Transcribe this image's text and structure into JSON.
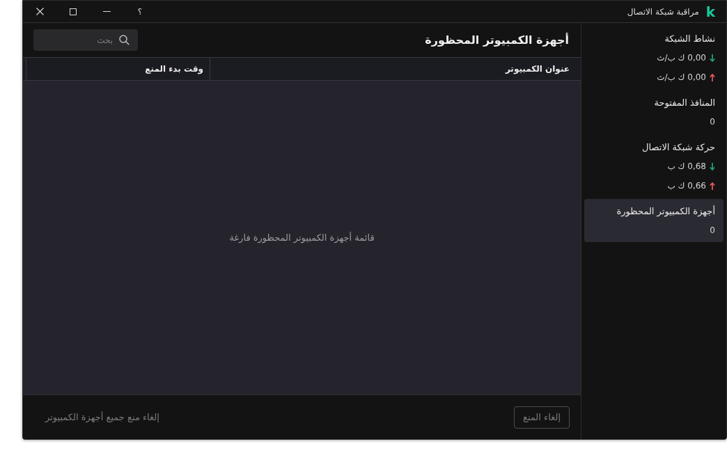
{
  "window": {
    "logo": "k",
    "title": "مراقبة شبكة الاتصال",
    "help": "؟"
  },
  "sidebar": {
    "items": [
      {
        "title": "نشاط الشبكة",
        "selected": false,
        "values": [
          {
            "kind": "down",
            "text": "0,00 ك ب/ث"
          },
          {
            "kind": "up",
            "text": "0,00 ك ب/ث"
          }
        ]
      },
      {
        "title": "المنافذ المفتوحة",
        "selected": false,
        "values": [
          {
            "kind": "plain",
            "text": "0"
          }
        ]
      },
      {
        "title": "حركة شبكة الاتصال",
        "selected": false,
        "values": [
          {
            "kind": "down",
            "text": "0,68 ك ب"
          },
          {
            "kind": "up",
            "text": "0,66 ك ب"
          }
        ]
      },
      {
        "title": "أجهزة الكمبيوتر المحظورة",
        "selected": true,
        "values": [
          {
            "kind": "plain",
            "text": "0"
          }
        ]
      }
    ]
  },
  "main": {
    "title": "أجهزة الكمبيوتر المحظورة",
    "search": {
      "placeholder": "بحث"
    }
  },
  "table": {
    "columns": [
      {
        "label": "عنوان الكمبيوتر"
      },
      {
        "label": "وقت بدء المنع"
      }
    ],
    "empty_message": "قائمة أجهزة الكمبيوتر المحظورة فارغة"
  },
  "footer": {
    "unblock_button": {
      "label": "إلغاء المنع",
      "disabled": true
    },
    "unblock_all_link": {
      "label": "إلغاء منع جميع أجهزة الكمبيوتر",
      "disabled": true
    }
  }
}
